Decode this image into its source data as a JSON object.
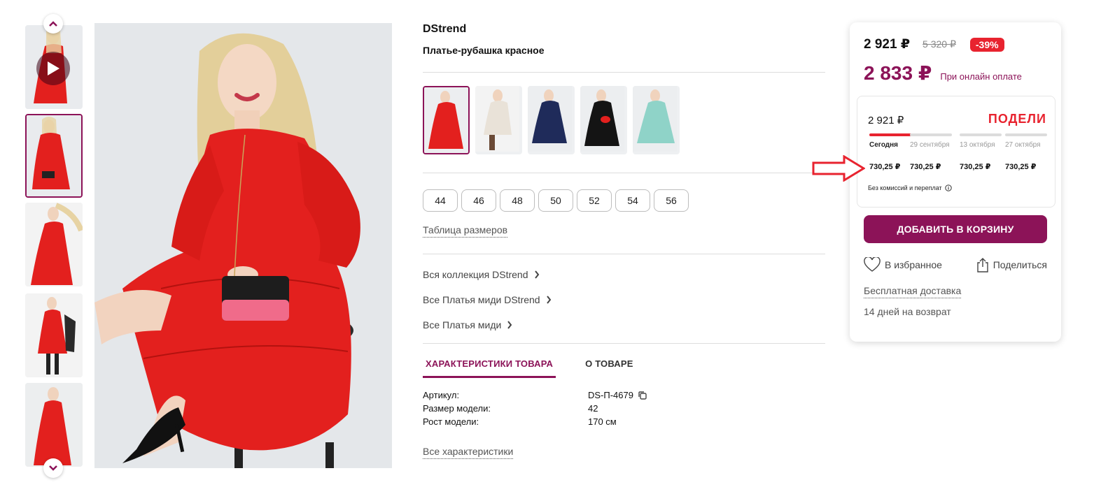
{
  "product": {
    "brand": "DStrend",
    "title": "Платье-рубашка красное"
  },
  "colors": {
    "primary": "#8c1358",
    "sale_badge": "#e8232f",
    "podeli": "#e8232f",
    "dress_red": "#e3201e"
  },
  "gallery": {
    "thumb_count": 5,
    "active_thumb": 2,
    "main_image": "red-dress-model-photo"
  },
  "color_variants": [
    "red",
    "beige",
    "navy",
    "black",
    "mint"
  ],
  "sizes": [
    "44",
    "46",
    "48",
    "50",
    "52",
    "54",
    "56"
  ],
  "size_chart_label": "Таблица размеров",
  "collection_links": [
    "Вся коллекция DStrend",
    "Все Платья миди DStrend",
    "Все Платья миди"
  ],
  "tabs": [
    "ХАРАКТЕРИСТИКИ ТОВАРА",
    "О ТОВАРЕ"
  ],
  "specs": [
    {
      "label": "Артикул:",
      "value": "DS-П-4679"
    },
    {
      "label": "Размер модели:",
      "value": "42"
    },
    {
      "label": "Рост модели:",
      "value": "170 см"
    }
  ],
  "all_specs_label": "Все характеристики",
  "price_card": {
    "price": "2 921 ₽",
    "old_price": "5 320 ₽",
    "discount": "-39%",
    "online_price": "2 833 ₽",
    "online_label": "При онлайн оплате",
    "podeli": {
      "total": "2 921 ₽",
      "logo": "ПОДЕЛИ",
      "dates": [
        "Сегодня",
        "29 сентября",
        "13 октября",
        "27 октября"
      ],
      "amounts": [
        "730,25 ₽",
        "730,25 ₽",
        "730,25 ₽",
        "730,25 ₽"
      ],
      "note": "Без комиссий и переплат"
    },
    "add_to_cart": "ДОБАВИТЬ В КОРЗИНУ",
    "favorite": "В избранное",
    "share": "Поделиться",
    "free_delivery": "Бесплатная доставка",
    "returns": "14 дней на возврат"
  }
}
